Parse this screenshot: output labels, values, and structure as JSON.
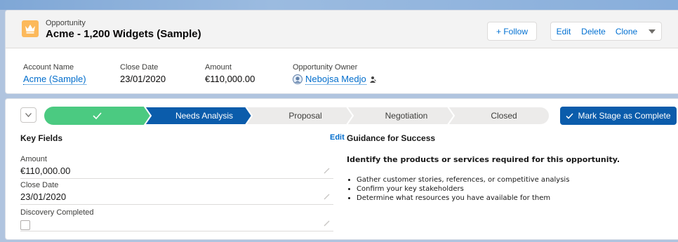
{
  "record": {
    "object_type": "Opportunity",
    "title": "Acme - 1,200 Widgets (Sample)",
    "object_icon": "crown-icon"
  },
  "actions": {
    "follow": "+ Follow",
    "edit": "Edit",
    "delete": "Delete",
    "clone": "Clone"
  },
  "highlights": {
    "account_label": "Account Name",
    "account_value": "Acme (Sample)",
    "close_label": "Close Date",
    "close_value": "23/01/2020",
    "amount_label": "Amount",
    "amount_value": "€110,000.00",
    "owner_label": "Opportunity Owner",
    "owner_value": "Nebojsa Medjo"
  },
  "path": {
    "steps": [
      {
        "label": "",
        "state": "complete"
      },
      {
        "label": "Needs Analysis",
        "state": "current"
      },
      {
        "label": "Proposal",
        "state": "incomplete"
      },
      {
        "label": "Negotiation",
        "state": "incomplete"
      },
      {
        "label": "Closed",
        "state": "incomplete"
      }
    ],
    "mark_complete": "Mark Stage as Complete",
    "colors": {
      "complete": "#4bca81",
      "current": "#0b5cab",
      "incomplete": "#ecebea"
    }
  },
  "key_fields": {
    "title": "Key Fields",
    "edit": "Edit",
    "fields": [
      {
        "label": "Amount",
        "value": "€110,000.00"
      },
      {
        "label": "Close Date",
        "value": "23/01/2020"
      },
      {
        "label": "Discovery Completed",
        "value": ""
      }
    ]
  },
  "guidance": {
    "title": "Guidance for Success",
    "heading": "Identify the products or services required for this opportunity.",
    "bullets": [
      "Gather customer stories, references, or competitive analysis",
      "Confirm your key stakeholders",
      "Determine what resources you have available for them"
    ]
  }
}
